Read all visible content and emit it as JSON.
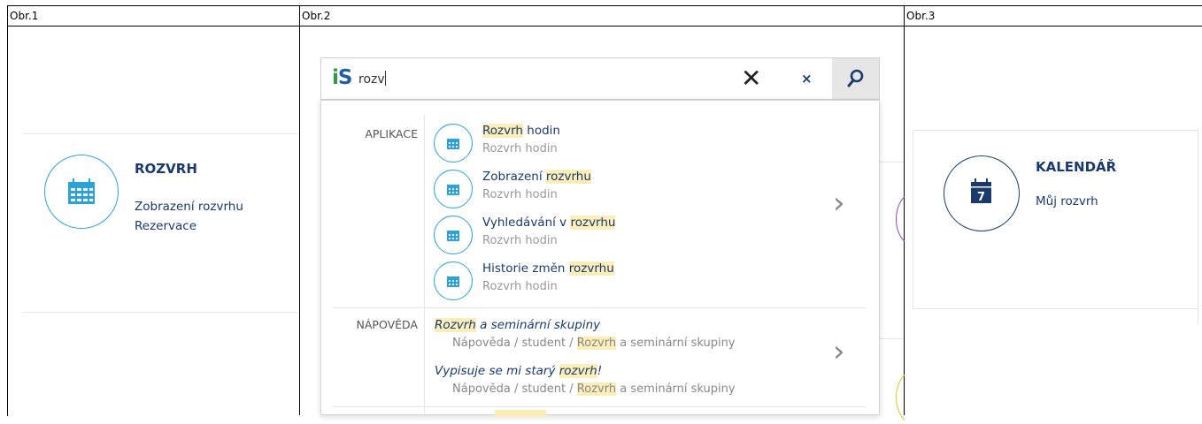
{
  "columns": {
    "col1_header": "Obr.1",
    "col2_header": "Obr.2",
    "col3_header": "Obr.3"
  },
  "tile_rozvrh": {
    "title": "ROZVRH",
    "links": [
      "Zobrazení rozvrhu",
      "Rezervace"
    ],
    "icon": "calendar-grid-icon",
    "accent": "#29a3da"
  },
  "tile_kalendar": {
    "title": "KALENDÁŘ",
    "links": [
      "Můj rozvrh"
    ],
    "icon": "calendar-day-icon",
    "icon_day": "7",
    "accent": "#1a3a6e"
  },
  "search": {
    "logo_i": "i",
    "logo_s": "S",
    "query": "rozv",
    "clear_big": "✕",
    "clear_small": "×",
    "search_icon": "magnifier-icon"
  },
  "results": {
    "apps_label": "APLIKACE",
    "apps": [
      {
        "pre": "",
        "hl": "Rozvrh",
        "post": " hodin",
        "sub": "Rozvrh hodin"
      },
      {
        "pre": "Zobrazení ",
        "hl": "rozvrhu",
        "post": "",
        "sub": "Rozvrh hodin"
      },
      {
        "pre": "Vyhledávání v ",
        "hl": "rozvrhu",
        "post": "",
        "sub": "Rozvrh hodin"
      },
      {
        "pre": "Historie změn ",
        "hl": "rozvrhu",
        "post": "",
        "sub": "Rozvrh hodin"
      }
    ],
    "help_label": "NÁPOVĚDA",
    "help": [
      {
        "pre": "",
        "hl": "Rozvrh",
        "post": " a seminární skupiny",
        "path_pre": "Nápověda / student / ",
        "path_hl": "Rozvrh",
        "path_post": " a seminární skupiny"
      },
      {
        "pre": "Vypisuje se mi starý ",
        "hl": "rozvrh",
        "post": "!",
        "path_pre": "Nápověda / student / ",
        "path_hl": "Rozvrh",
        "path_post": " a seminární skupiny"
      }
    ],
    "chevron": "›",
    "highlight_color": "#fbeeb8"
  }
}
